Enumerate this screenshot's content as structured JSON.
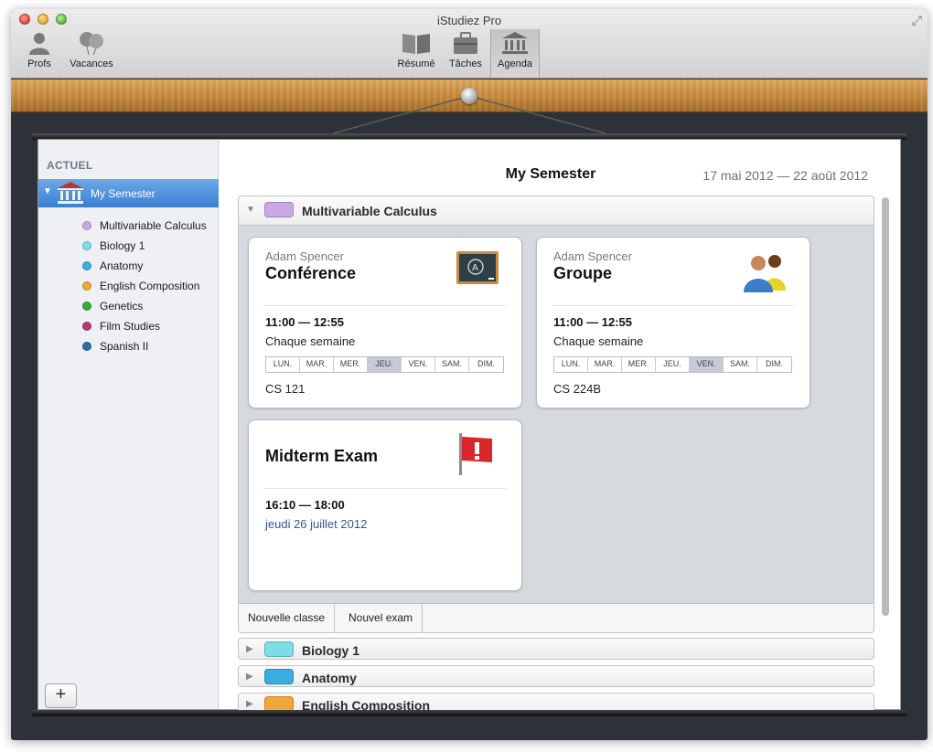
{
  "window": {
    "title": "iStudiez Pro"
  },
  "toolbar": {
    "left": [
      {
        "label": "Profs",
        "icon": "person-icon"
      },
      {
        "label": "Vacances",
        "icon": "balloons-icon"
      }
    ],
    "center": [
      {
        "label": "Résumé",
        "icon": "book-icon"
      },
      {
        "label": "Tâches",
        "icon": "briefcase-icon"
      },
      {
        "label": "Agenda",
        "icon": "bank-icon",
        "active": true
      }
    ]
  },
  "sidebar": {
    "section": "ACTUEL",
    "semester": "My Semester",
    "courses": [
      {
        "name": "Multivariable Calculus",
        "color": "#c8a8e6"
      },
      {
        "name": "Biology 1",
        "color": "#7ddce6"
      },
      {
        "name": "Anatomy",
        "color": "#3aaee0"
      },
      {
        "name": "English Composition",
        "color": "#f0a63a"
      },
      {
        "name": "Genetics",
        "color": "#3cab3a"
      },
      {
        "name": "Film Studies",
        "color": "#b03a78"
      },
      {
        "name": "Spanish II",
        "color": "#2f6fa0"
      }
    ],
    "add_label": "+"
  },
  "main": {
    "title": "My Semester",
    "dates": "17 mai 2012 — 22 août 2012",
    "expanded_group": {
      "name": "Multivariable Calculus",
      "color": "#c8a8e6",
      "cards": [
        {
          "professor": "Adam Spencer",
          "title": "Conférence",
          "icon": "chalkboard-icon",
          "time": "11:00 — 12:55",
          "frequency": "Chaque semaine",
          "days": [
            {
              "label": "LUN.",
              "on": false
            },
            {
              "label": "MAR.",
              "on": false
            },
            {
              "label": "MER.",
              "on": false
            },
            {
              "label": "JEU.",
              "on": true
            },
            {
              "label": "VEN.",
              "on": false
            },
            {
              "label": "SAM.",
              "on": false
            },
            {
              "label": "DIM.",
              "on": false
            }
          ],
          "room": "CS 121"
        },
        {
          "professor": "Adam Spencer",
          "title": "Groupe",
          "icon": "people-icon",
          "time": "11:00 — 12:55",
          "frequency": "Chaque semaine",
          "days": [
            {
              "label": "LUN.",
              "on": false
            },
            {
              "label": "MAR.",
              "on": false
            },
            {
              "label": "MER.",
              "on": false
            },
            {
              "label": "JEU.",
              "on": false
            },
            {
              "label": "VEN.",
              "on": true
            },
            {
              "label": "SAM.",
              "on": false
            },
            {
              "label": "DIM.",
              "on": false
            }
          ],
          "room": "CS 224B"
        }
      ],
      "exam": {
        "title": "Midterm Exam",
        "icon": "flag-icon",
        "time": "16:10 — 18:00",
        "date": "jeudi 26 juillet 2012"
      },
      "actions": [
        "Nouvelle classe",
        "Nouvel exam"
      ]
    },
    "collapsed_groups": [
      {
        "name": "Biology 1",
        "color": "#7ddce6"
      },
      {
        "name": "Anatomy",
        "color": "#3aaee0"
      },
      {
        "name": "English Composition",
        "color": "#f0a63a"
      }
    ]
  }
}
